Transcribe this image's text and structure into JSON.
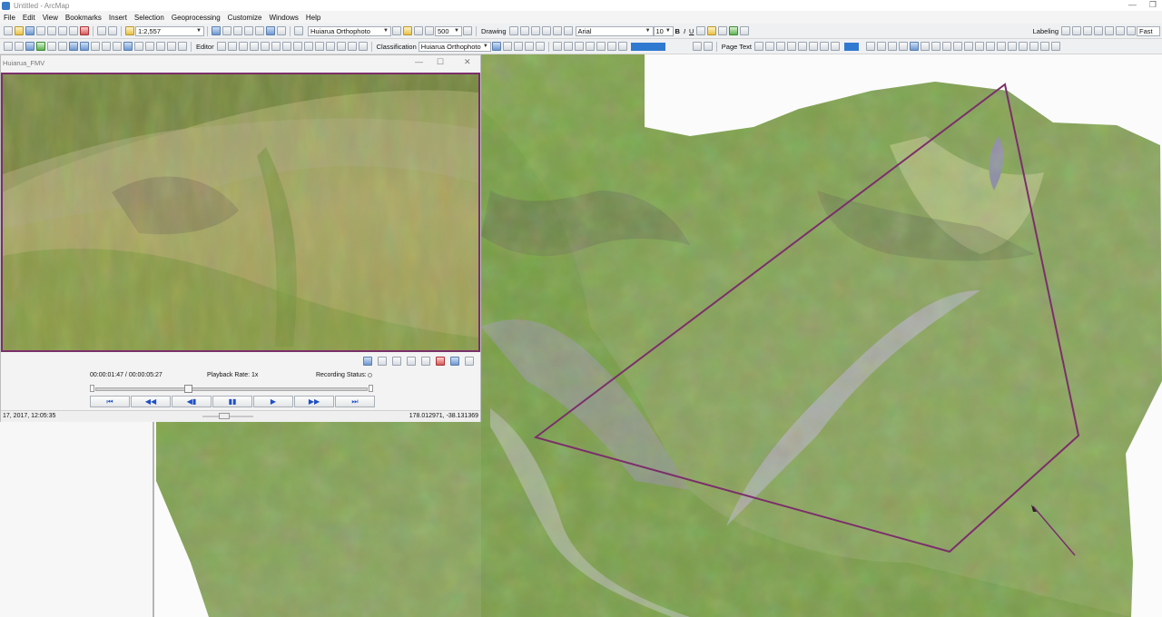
{
  "window": {
    "title": "Untitled - ArcMap"
  },
  "menu": [
    "File",
    "Edit",
    "View",
    "Bookmarks",
    "Insert",
    "Selection",
    "Geoprocessing",
    "Customize",
    "Windows",
    "Help"
  ],
  "toolbar": {
    "scale": "1:2,557",
    "layer_top": "Huiarua Orthophoto",
    "zoom_value": "500",
    "drawing_label": "Drawing",
    "font_name": "Arial",
    "font_size": "10",
    "bold": "B",
    "italic": "I",
    "underline": "U",
    "labeling_label": "Labeling",
    "fast_label": "Fast",
    "editor_label": "Editor",
    "classification_label": "Classification",
    "layer_bottom": "Huiarua Orthophoto",
    "page_text_label": "Page Text"
  },
  "fmv": {
    "window_title": "Huiarua_FMV",
    "playback_time": "00:00:01:47 / 00:00:05:27",
    "playback_rate": "Playback Rate: 1x",
    "recording_status": "Recording Status:",
    "datetime": "17, 2017, 12:05:35",
    "coordinates": "178.012971, -38.131369",
    "progress_fraction": 0.34
  },
  "colors": {
    "footprint": "#7b2f6a",
    "accent": "#2f7ad0",
    "player_icon": "#1e4fc6"
  }
}
